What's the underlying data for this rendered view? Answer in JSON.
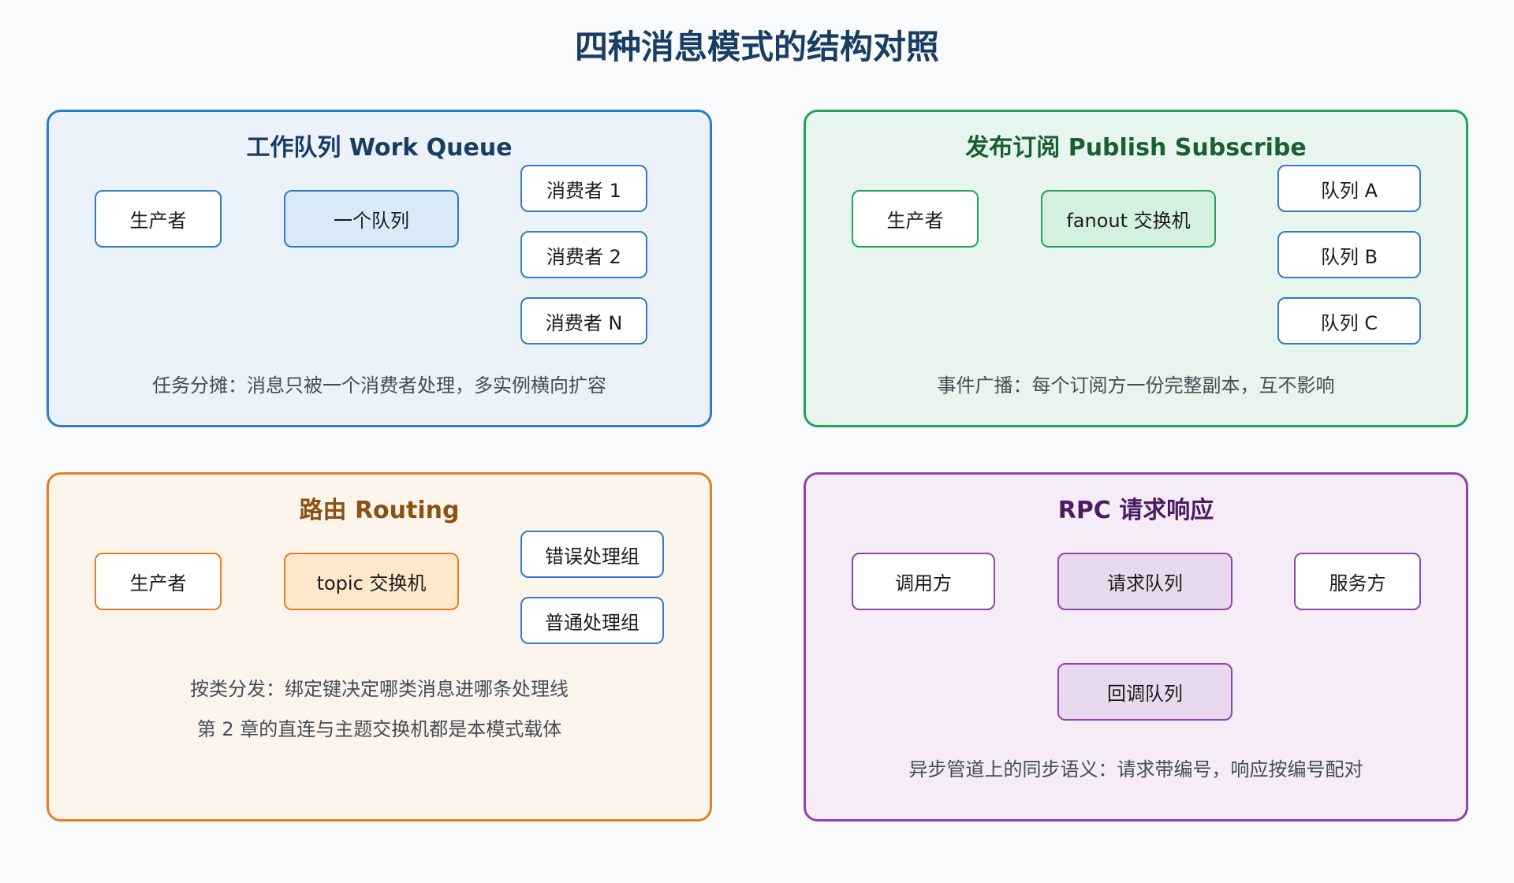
{
  "title": "四种消息模式的结构对照",
  "panels": {
    "work_queue": {
      "title": "工作队列 Work Queue",
      "producer": "生产者",
      "queue": "一个队列",
      "consumers": [
        "消费者 1",
        "消费者 2",
        "消费者 N"
      ],
      "caption": "任务分摊：消息只被一个消费者处理，多实例横向扩容"
    },
    "pub_sub": {
      "title": "发布订阅 Publish Subscribe",
      "producer": "生产者",
      "exchange": "fanout 交换机",
      "queues": [
        "队列 A",
        "队列 B",
        "队列 C"
      ],
      "caption": "事件广播：每个订阅方一份完整副本，互不影响"
    },
    "routing": {
      "title": "路由 Routing",
      "producer": "生产者",
      "exchange": "topic 交换机",
      "groups": [
        "错误处理组",
        "普通处理组"
      ],
      "caption_lines": [
        "按类分发：绑定键决定哪类消息进哪条处理线",
        "第 2 章的直连与主题交换机都是本模式载体"
      ]
    },
    "rpc": {
      "title": "RPC 请求响应",
      "caller": "调用方",
      "request_queue": "请求队列",
      "server": "服务方",
      "callback_queue": "回调队列",
      "caption": "异步管道上的同步语义：请求带编号，响应按编号配对"
    }
  },
  "colors": {
    "work_queue": "#2f7ccb",
    "pub_sub": "#22a35a",
    "routing": "#e67e22",
    "rpc": "#8e44ad",
    "title": "#1a3d63"
  }
}
